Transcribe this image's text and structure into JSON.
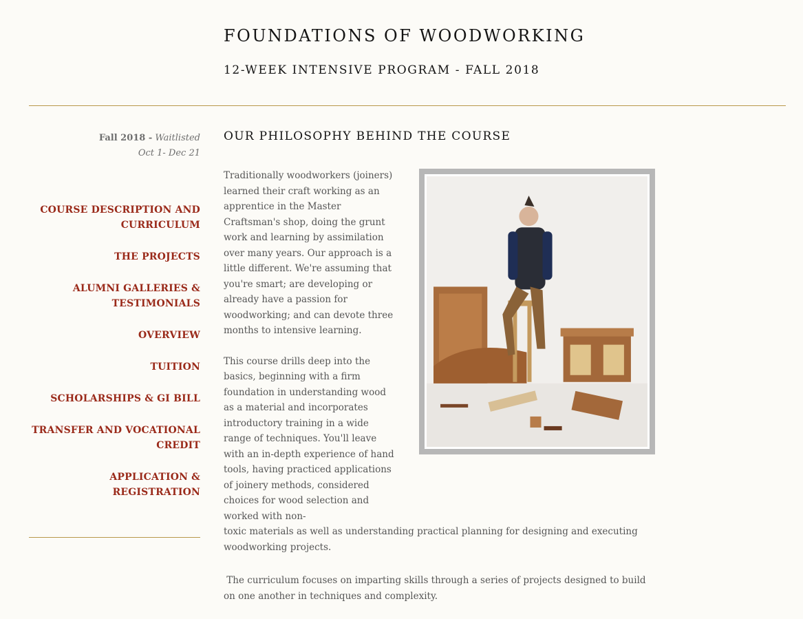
{
  "header": {
    "title": "FOUNDATIONS OF WOODWORKING",
    "subtitle": "12-WEEK INTENSIVE PROGRAM - FALL 2018"
  },
  "sidebar": {
    "session_term": "Fall 2018 -",
    "session_status": "Waitlisted",
    "session_dates": "Oct 1- Dec 21",
    "nav": [
      {
        "label": "COURSE DESCRIPTION AND CURRICULUM"
      },
      {
        "label": "THE PROJECTS"
      },
      {
        "label": "ALUMNI GALLERIES & TESTIMONIALS"
      },
      {
        "label": "OVERVIEW"
      },
      {
        "label": "TUITION"
      },
      {
        "label": "SCHOLARSHIPS & GI BILL"
      },
      {
        "label": "TRANSFER AND VOCATIONAL CREDIT"
      },
      {
        "label": "APPLICATION & REGISTRATION"
      }
    ]
  },
  "main": {
    "heading": "OUR PHILOSOPHY BEHIND THE COURSE",
    "para1": "Traditionally woodworkers  (joiners) learned their craft working as an apprentice in the Master Craftsman's shop, doing the grunt work and learning by assimilation over many years. Our approach is a little different. We're assuming that you're smart; are developing or already have a passion for woodworking; and can devote three months to intensive learning.",
    "para2a": "This course drills deep into the basics, beginning with a firm foundation in understanding wood as a material and incorporates introductory training in a wide range of techniques. You'll leave with an in-depth experience of hand tools, having practiced applications of joinery methods, considered choices for wood selection and worked with non-",
    "para2b": "toxic materials as well as understanding practical planning for designing and executing woodworking projects.",
    "para3": " The curriculum focuses on imparting skills through a series of projects designed to build on one another in techniques and complexity."
  },
  "colors": {
    "accent_link": "#9a2a1a",
    "rule": "#b8974a",
    "background": "#fcfbf7"
  }
}
